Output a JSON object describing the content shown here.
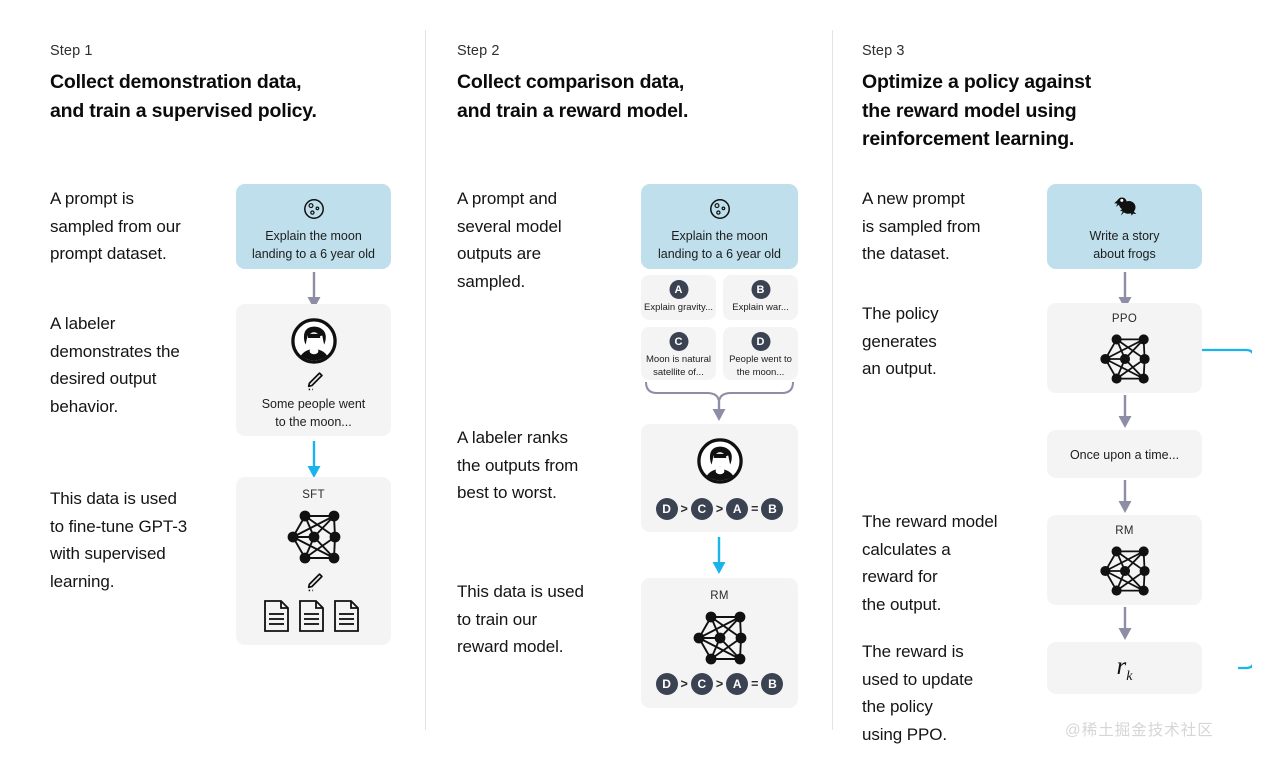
{
  "steps": [
    {
      "label": "Step 1",
      "heading": "Collect demonstration data,\nand train a supervised policy.",
      "paragraphs": [
        "A prompt is\nsampled from our\nprompt dataset.",
        "A labeler\ndemonstrates the\ndesired output\nbehavior.",
        "This data is used\nto fine-tune GPT-3\nwith supervised\nlearning."
      ],
      "cards": {
        "prompt": {
          "text": "Explain the moon\nlanding to a 6 year old",
          "icon": "moon-icon"
        },
        "labeler": {
          "text": "Some people went\nto the moon...",
          "icon": "person-icon",
          "pencil": "pencil-icon"
        },
        "model": {
          "title": "SFT",
          "icon": "neural-network-icon",
          "pencil": "pencil-icon",
          "docs": "documents-icon"
        }
      }
    },
    {
      "label": "Step 2",
      "heading": "Collect comparison data,\nand train a reward model.",
      "paragraphs": [
        "A prompt and\nseveral model\noutputs are\nsampled.",
        "A labeler ranks\nthe outputs from\nbest to worst.",
        "This data is used\nto train our\nreward model."
      ],
      "cards": {
        "prompt": {
          "text": "Explain the moon\nlanding to a 6 year old",
          "icon": "moon-icon"
        },
        "outputs": [
          {
            "badge": "A",
            "text": "Explain gravity..."
          },
          {
            "badge": "B",
            "text": "Explain war..."
          },
          {
            "badge": "C",
            "text": "Moon is natural\nsatellite of..."
          },
          {
            "badge": "D",
            "text": "People went to\nthe moon..."
          }
        ],
        "ranking": {
          "icon": "person-icon",
          "tokens": [
            "D",
            ">",
            "C",
            ">",
            "A",
            "=",
            "B"
          ]
        },
        "model": {
          "title": "RM",
          "icon": "neural-network-icon",
          "tokens": [
            "D",
            ">",
            "C",
            ">",
            "A",
            "=",
            "B"
          ]
        }
      }
    },
    {
      "label": "Step 3",
      "heading": "Optimize a policy against\nthe reward model using\nreinforcement learning.",
      "paragraphs": [
        "A new prompt\nis sampled from\nthe dataset.",
        "The policy\ngenerates\nan output.",
        "The reward model\ncalculates a\nreward for\nthe output.",
        "The reward is\nused to update\nthe policy\nusing PPO."
      ],
      "cards": {
        "prompt": {
          "text": "Write a story\nabout frogs",
          "icon": "frog-icon"
        },
        "policy": {
          "title": "PPO",
          "icon": "neural-network-icon"
        },
        "output": {
          "text": "Once upon a time..."
        },
        "reward_model": {
          "title": "RM",
          "icon": "neural-network-icon"
        },
        "reward": {
          "text": "r",
          "subscript": "k"
        }
      }
    }
  ],
  "watermark": "@稀土掘金技术社区",
  "colors": {
    "prompt_card": "#bfdfec",
    "neutral_card": "#f4f4f4",
    "gray_arrow": "#8d8da5",
    "cyan_arrow": "#1ab4ea",
    "badge": "#3b4252",
    "divider": "#e3e3e3"
  }
}
